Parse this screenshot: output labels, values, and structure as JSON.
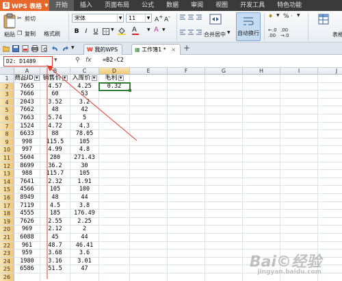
{
  "app": {
    "name": "WPS 表格",
    "logo": "S"
  },
  "menu": [
    "开始",
    "插入",
    "页面布局",
    "公式",
    "数据",
    "审阅",
    "视图",
    "开发工具",
    "特色功能"
  ],
  "ribbon": {
    "paste": "粘贴",
    "cut": "剪切",
    "copy": "复制",
    "format_painter": "格式刷",
    "font": "宋体",
    "size": "11",
    "bold": "B",
    "italic": "I",
    "underline": "U",
    "merge_center": "合并居中",
    "wrap": "自动换行",
    "table_style": "表格",
    "percent": "%",
    "comma": "♦"
  },
  "tabs": [
    {
      "label": "我的WPS"
    },
    {
      "label": "工作簿1 *"
    }
  ],
  "formula_bar": {
    "name_box": "D2: D1489",
    "fx": "fx",
    "formula": "=B2-C2"
  },
  "columns": [
    "A",
    "B",
    "C",
    "D",
    "E",
    "F",
    "G",
    "H",
    "I",
    "J"
  ],
  "headers": [
    "商品ID",
    "销售价",
    "入库价",
    "毛利"
  ],
  "rows": [
    [
      "7665",
      "4.57",
      "4.25",
      "0.32"
    ],
    [
      "7666",
      "60",
      "53",
      ""
    ],
    [
      "2043",
      "3.52",
      "3.2",
      ""
    ],
    [
      "7662",
      "48",
      "42",
      ""
    ],
    [
      "7663",
      "5.74",
      "5",
      ""
    ],
    [
      "1524",
      "4.72",
      "4.3",
      ""
    ],
    [
      "6633",
      "88",
      "78.05",
      ""
    ],
    [
      "998",
      "115.5",
      "105",
      ""
    ],
    [
      "997",
      "4.99",
      "4.8",
      ""
    ],
    [
      "5604",
      "280",
      "271.43",
      ""
    ],
    [
      "8699",
      "36.2",
      "30",
      ""
    ],
    [
      "988",
      "115.7",
      "105",
      ""
    ],
    [
      "7641",
      "2.32",
      "1.91",
      ""
    ],
    [
      "4566",
      "105",
      "100",
      ""
    ],
    [
      "8949",
      "48",
      "44",
      ""
    ],
    [
      "7119",
      "4.5",
      "3.8",
      ""
    ],
    [
      "4555",
      "185",
      "176.49",
      ""
    ],
    [
      "7626",
      "2.55",
      "2.25",
      ""
    ],
    [
      "969",
      "2.12",
      "2",
      ""
    ],
    [
      "6088",
      "45",
      "44",
      ""
    ],
    [
      "961",
      "48.7",
      "46.41",
      ""
    ],
    [
      "959",
      "3.68",
      "3.6",
      ""
    ],
    [
      "1980",
      "3.16",
      "3.01",
      ""
    ],
    [
      "6586",
      "51.5",
      "47",
      ""
    ],
    [
      "",
      "",
      "",
      ""
    ]
  ],
  "watermark": {
    "main": "Bai©经验",
    "sub": "jingyan.baidu.com"
  }
}
